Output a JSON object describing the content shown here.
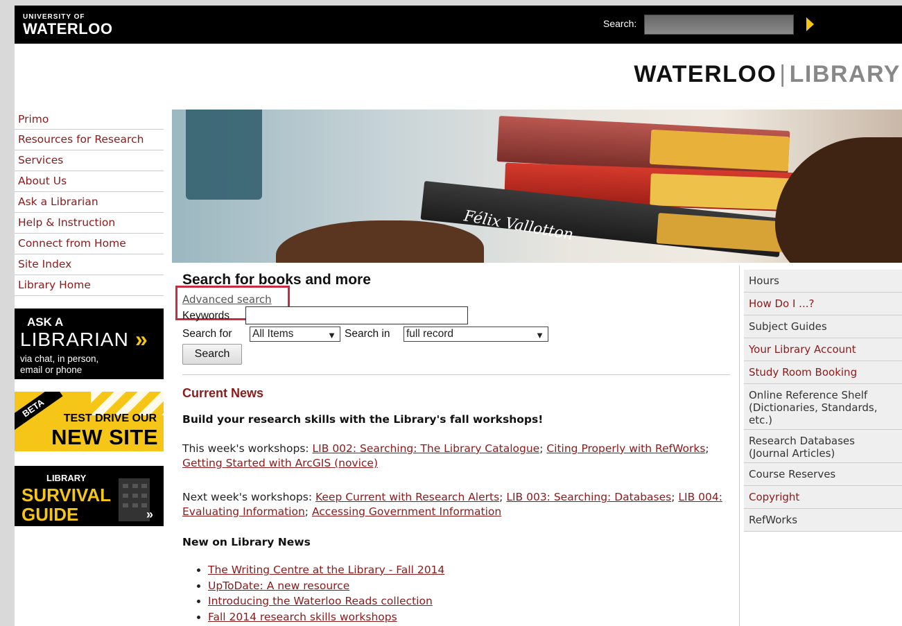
{
  "header": {
    "uw_small": "UNIVERSITY OF",
    "uw_big": "WATERLOO",
    "search_label": "Search:"
  },
  "wordmark": {
    "left": "WATERLOO",
    "separator": "|",
    "right": "LIBRARY"
  },
  "leftnav": {
    "items": [
      {
        "label": "Primo"
      },
      {
        "label": "Resources for Research"
      },
      {
        "label": "Services"
      },
      {
        "label": "About Us"
      },
      {
        "label": "Ask a Librarian"
      },
      {
        "label": "Help & Instruction"
      },
      {
        "label": "Connect from Home"
      },
      {
        "label": "Site Index"
      },
      {
        "label": "Library Home"
      }
    ]
  },
  "promos": {
    "ask": {
      "line1": "ASK A",
      "line2": "LIBRARIAN",
      "chevrons": "»",
      "line3": "via chat, in person,",
      "line4": "email or phone"
    },
    "beta": {
      "ribbon": "BETA",
      "line1": "TEST DRIVE OUR",
      "line2": "NEW SITE"
    },
    "guide": {
      "line1": "LIBRARY",
      "line2": "SURVIVAL",
      "line3": "GUIDE",
      "arrows": "»"
    }
  },
  "hero": {
    "spine_text": "Félix Vallotton"
  },
  "search": {
    "title": "Search for books and more",
    "advanced_link": "Advanced search",
    "keywords_label": "Keywords",
    "keywords_value": "",
    "search_for_label": "Search for",
    "search_for_value": "All Items",
    "search_in_label": "Search in",
    "search_in_value": "full record",
    "button_label": "Search"
  },
  "news": {
    "title": "Current News",
    "headline": "Build your research skills with the Library's fall workshops!",
    "this_week_prefix": "This week's workshops: ",
    "this_week_links": [
      "LIB 002: Searching: The Library Catalogue",
      "Citing Properly with RefWorks",
      "Getting Started with ArcGIS (novice)"
    ],
    "next_week_prefix": "Next week's workshops: ",
    "next_week_links": [
      "Keep Current with Research Alerts",
      "LIB 003: Searching: Databases",
      "LIB 004: Evaluating Information",
      "Accessing Government Information"
    ],
    "separator": "; ",
    "library_news_title": "New on Library News",
    "library_news_items": [
      "The Writing Centre at the Library - Fall 2014",
      "UpToDate: A new resource",
      "Introducing the Waterloo Reads collection",
      "Fall 2014 research skills workshops"
    ]
  },
  "rightnav": {
    "items": [
      {
        "label": "Hours"
      },
      {
        "label": "How Do I ...?"
      },
      {
        "label": "Subject Guides"
      },
      {
        "label": "Your Library Account"
      },
      {
        "label": "Study Room Booking"
      },
      {
        "label": "Online Reference Shelf (Dictionaries, Standards, etc.)"
      },
      {
        "label": "Research Databases (Journal Articles)"
      },
      {
        "label": "Course Reserves"
      },
      {
        "label": "Copyright"
      },
      {
        "label": "RefWorks"
      }
    ]
  },
  "colors": {
    "link_red": "#8b1a1a",
    "highlight": "#c72c41",
    "gold": "#f5c518",
    "topbar": "#000000"
  }
}
